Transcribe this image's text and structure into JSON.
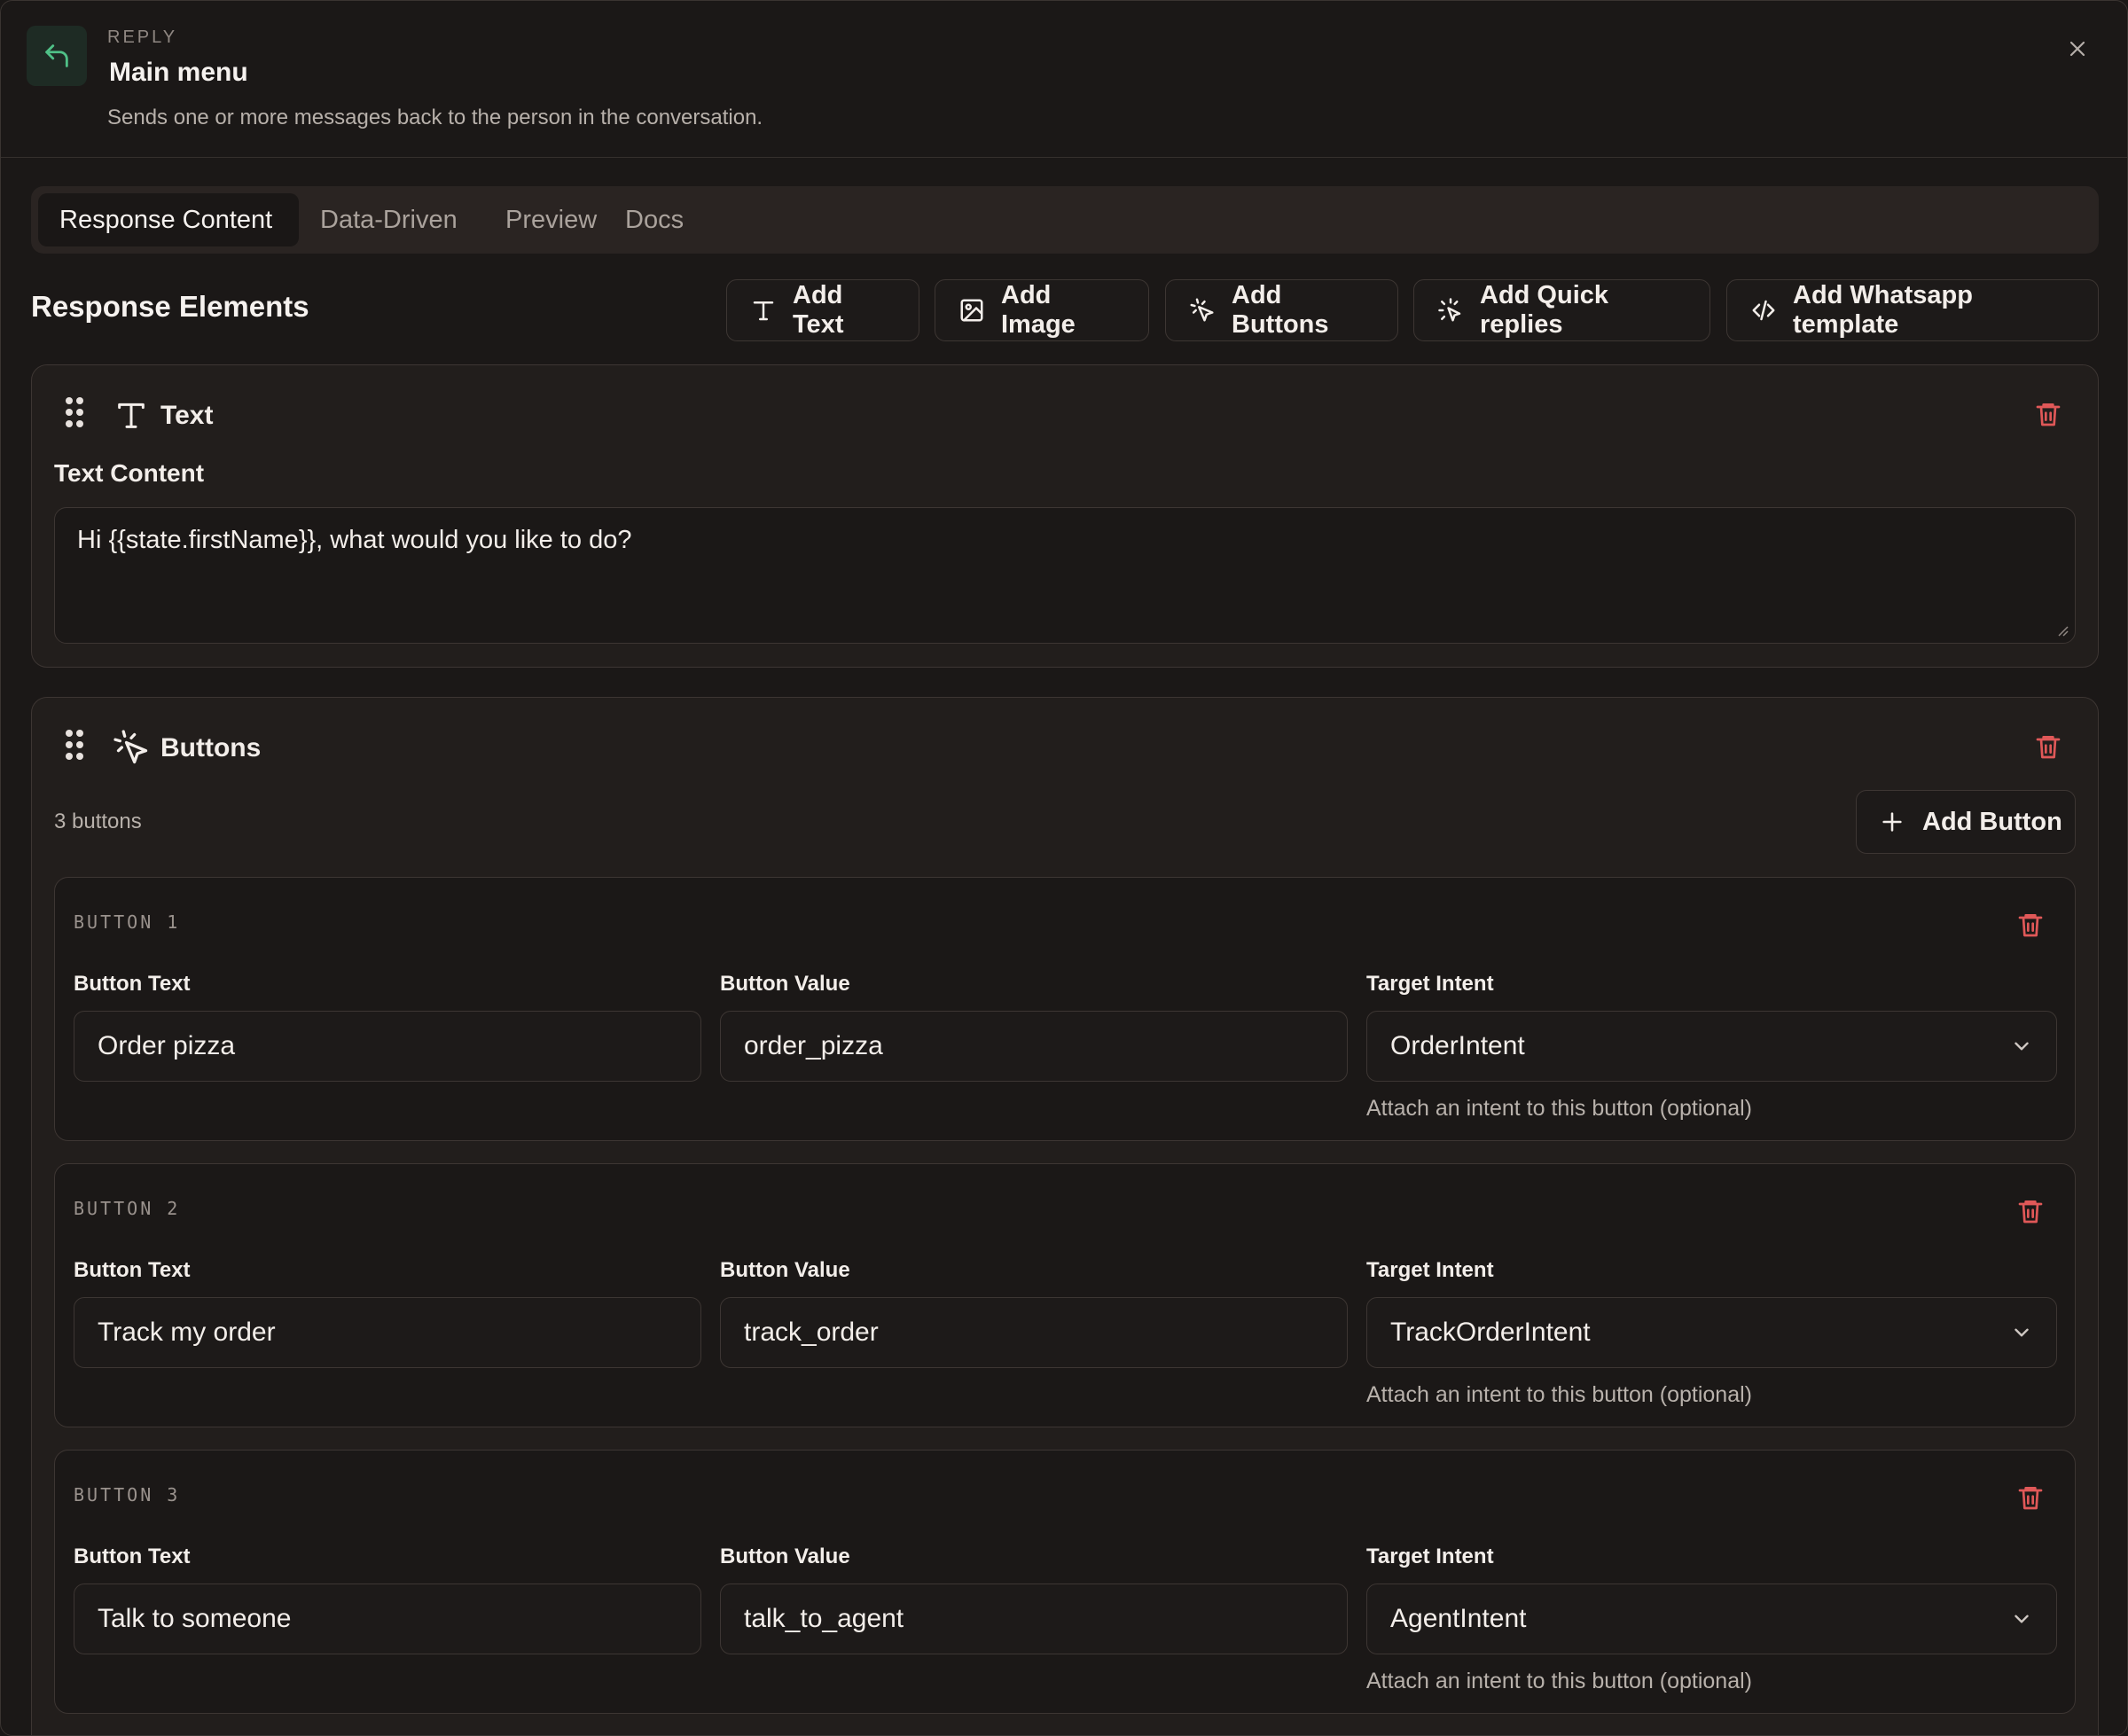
{
  "header": {
    "kicker": "REPLY",
    "title": "Main menu",
    "description": "Sends one or more messages back to the person in the conversation."
  },
  "tabs": [
    {
      "label": "Response Content",
      "active": true
    },
    {
      "label": "Data-Driven",
      "active": false
    },
    {
      "label": "Preview",
      "active": false
    },
    {
      "label": "Docs",
      "active": false
    }
  ],
  "toolbar": {
    "section_title": "Response Elements",
    "add_text": "Add Text",
    "add_image": "Add Image",
    "add_buttons": "Add Buttons",
    "add_quick_replies": "Add Quick replies",
    "add_whatsapp": "Add Whatsapp template"
  },
  "text_element": {
    "title": "Text",
    "content_label": "Text Content",
    "content_value": "Hi {{state.firstName}}, what would you like to do?"
  },
  "buttons_element": {
    "title": "Buttons",
    "count_text": "3 buttons",
    "add_button_label": "Add Button",
    "field_labels": {
      "text": "Button Text",
      "value": "Button Value",
      "intent": "Target Intent"
    },
    "intent_hint": "Attach an intent to this button (optional)",
    "items": [
      {
        "kicker": "BUTTON 1",
        "text": "Order pizza",
        "value": "order_pizza",
        "intent": "OrderIntent"
      },
      {
        "kicker": "BUTTON 2",
        "text": "Track my order",
        "value": "track_order",
        "intent": "TrackOrderIntent"
      },
      {
        "kicker": "BUTTON 3",
        "text": "Talk to someone",
        "value": "talk_to_agent",
        "intent": "AgentIntent"
      }
    ]
  },
  "colors": {
    "accent_green": "#4fc187",
    "danger": "#e05858",
    "background": "#1b1817"
  },
  "icons": [
    "reply-icon",
    "close-icon",
    "text-icon",
    "image-icon",
    "pointer-click-icon",
    "sparkle-click-icon",
    "code-icon",
    "drag-handle-icon",
    "trash-icon",
    "plus-icon",
    "chevron-down-icon"
  ]
}
